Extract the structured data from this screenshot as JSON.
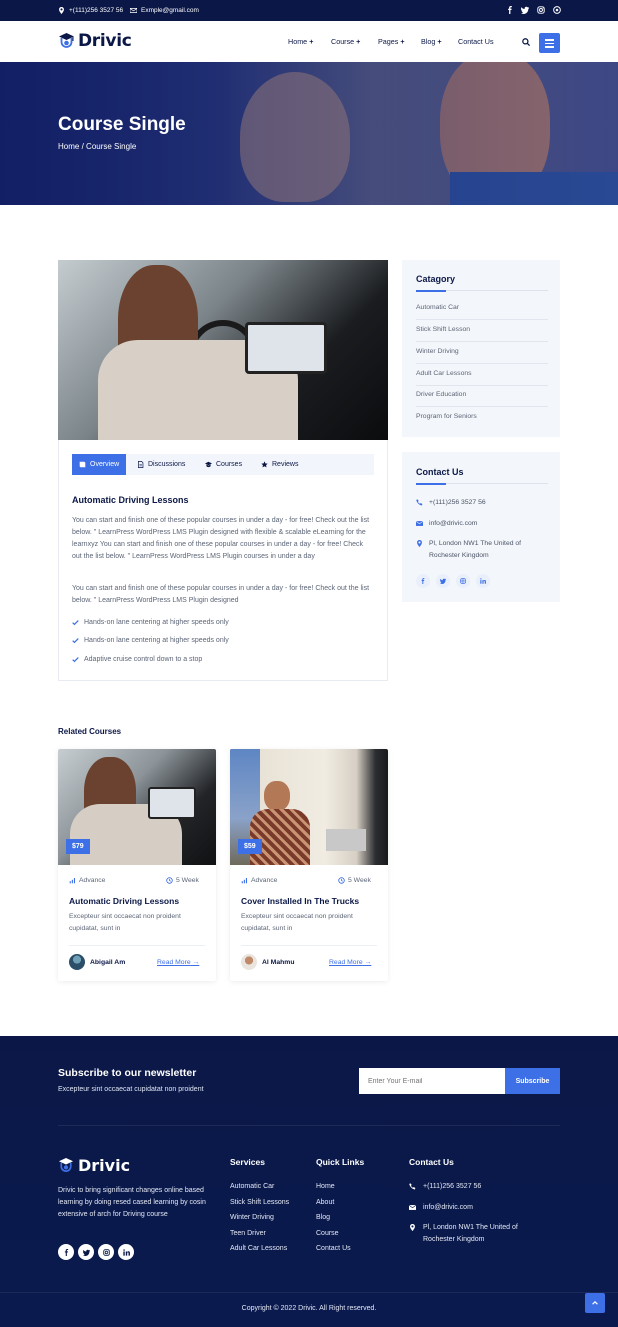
{
  "topbar": {
    "phone": "+(111)256 3527 56",
    "email": "Exmple@gmail.com",
    "social_icons": [
      "facebook-icon",
      "twitter-icon",
      "instagram-icon",
      "dribbble-icon"
    ]
  },
  "header": {
    "logo_text": "Drivic",
    "nav": [
      {
        "label": "Home",
        "has_dropdown": true
      },
      {
        "label": "Course",
        "has_dropdown": true
      },
      {
        "label": "Pages",
        "has_dropdown": true
      },
      {
        "label": "Blog",
        "has_dropdown": true
      },
      {
        "label": "Contact Us",
        "has_dropdown": false
      }
    ],
    "plus_glyph": "+"
  },
  "hero": {
    "title": "Course Single",
    "breadcrumb_home": "Home",
    "breadcrumb_sep": "/",
    "breadcrumb_current": "Course Single"
  },
  "course": {
    "tabs": [
      {
        "label": "Overview",
        "icon": "book-icon",
        "active": true
      },
      {
        "label": "Discussions",
        "icon": "document-icon",
        "active": false
      },
      {
        "label": "Courses",
        "icon": "graduation-cap-icon",
        "active": false
      },
      {
        "label": "Reviews",
        "icon": "star-icon",
        "active": false
      }
    ],
    "title": "Automatic Driving Lessons",
    "paragraph1": "You can start and finish one of these popular courses in under a day - for free! Check out the list below. \" LearnPress WordPress LMS Plugin designed with flexible & scalable eLearning for the learnxyz You can start and finish one of these popular courses in under a day - for free! Check out the list below. \" LearnPress WordPress LMS Plugin courses in under a day",
    "paragraph2": "You can start and finish one of these popular courses in under a day - for free! Check out the list below. \" LearnPress WordPress LMS Plugin designed",
    "features": [
      "Hands-on lane centering at higher speeds only",
      "Hands-on lane centering at higher speeds only",
      "Adaptive cruise control down to a stop"
    ]
  },
  "sidebar": {
    "category_title": "Catagory",
    "categories": [
      "Automatic Car",
      "Stick Shift Lesson",
      "Winter Driving",
      "Adult Car Lessons",
      "Driver Education",
      "Program for Seniors"
    ],
    "contact_title": "Contact Us",
    "contact_phone": "+(111)256 3527 56",
    "contact_email": "info@drivic.com",
    "contact_address": "Pl, London NW1 The United of Rochester Kingdom",
    "social_icons": [
      "facebook-icon",
      "twitter-icon",
      "instagram-icon",
      "linkedin-icon"
    ]
  },
  "related": {
    "title": "Related Courses",
    "cards": [
      {
        "price": "$79",
        "level": "Advance",
        "duration": "5 Week",
        "title": "Automatic Driving Lessons",
        "description": "Excepteur sint occaecat non proident cupidatat, sunt in",
        "author": "Abigail Am",
        "read_more": "Read More"
      },
      {
        "price": "$59",
        "level": "Advance",
        "duration": "5 Week",
        "title": "Cover Installed In The Trucks",
        "description": "Excepteur sint occaecat non proident cupidatat, sunt in",
        "author": "Al Mahmu",
        "read_more": "Read More"
      }
    ],
    "arrow_glyph": "→"
  },
  "footer": {
    "newsletter_title": "Subscribe to our newsletter",
    "newsletter_sub": "Excepteur sint occaecat cupidatat non proident",
    "email_placeholder": "Enter Your E-mail",
    "subscribe_label": "Subscribe",
    "logo_text": "Drivic",
    "about": "Drivic to bring significant changes online based learning by doing resed cased learning by cosin extensive of arch for Driving course",
    "services_title": "Services",
    "services": [
      "Automatic Car",
      "Stick Shift Lessons",
      "Winter Driving",
      "Teen Driver",
      "Adult Car Lessons"
    ],
    "quick_title": "Quick Links",
    "quick_links": [
      "Home",
      "About",
      "Blog",
      "Course",
      "Contact Us"
    ],
    "contact_title": "Contact Us",
    "contact_phone": "+(111)256 3527 56",
    "contact_email": "info@drivic.com",
    "contact_address": "Pl, London NW1 The United of Rochester Kingdom",
    "copyright": "Copyright © 2022 Drivic. All Right reserved."
  },
  "colors": {
    "accent": "#3d6fe6",
    "navy": "#0b1847",
    "text_muted": "#5c6577",
    "sidebar_bg": "#f3f6fa"
  }
}
